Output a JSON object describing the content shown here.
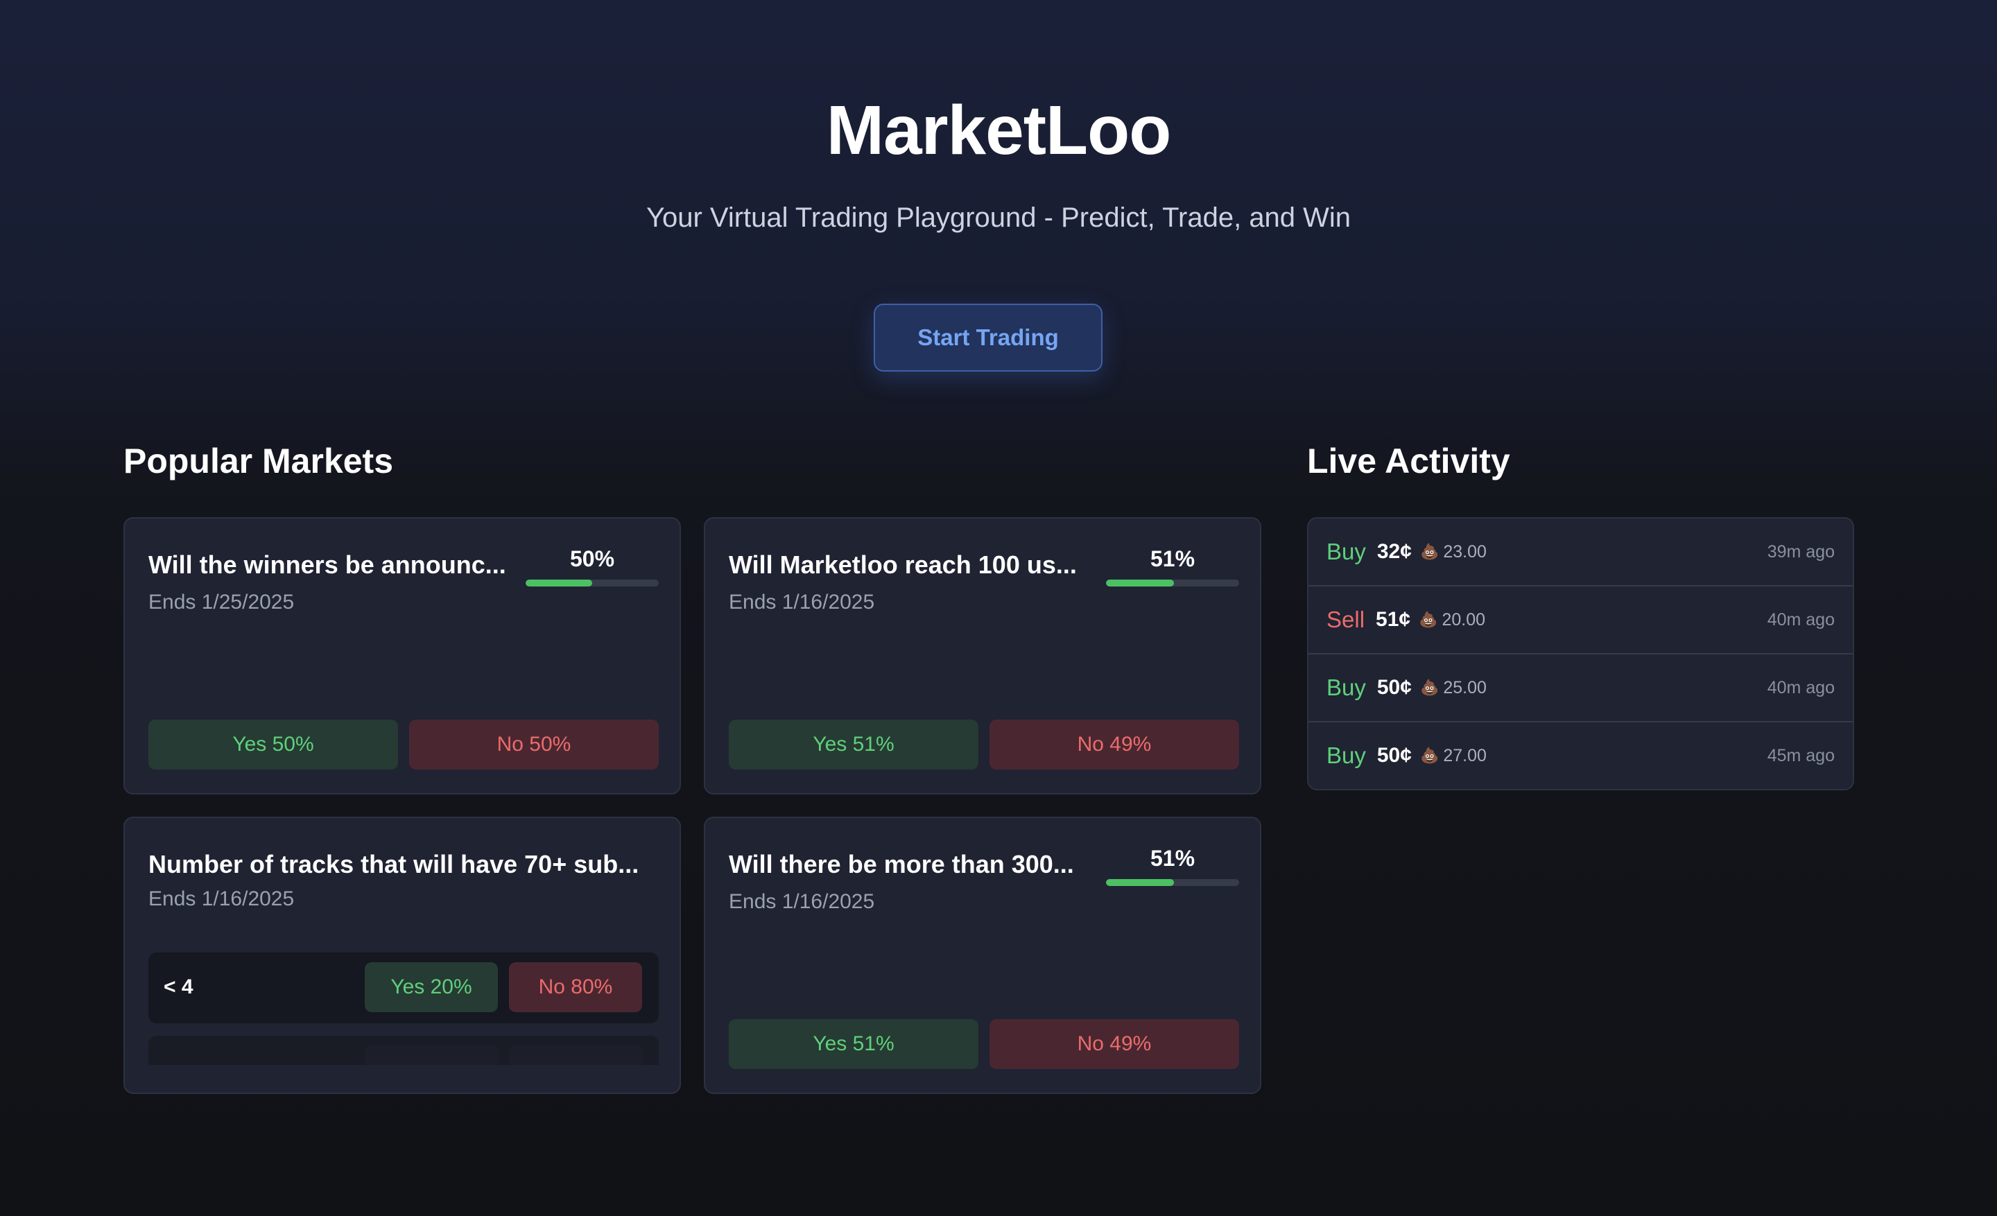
{
  "hero": {
    "title": "MarketLoo",
    "subtitle": "Your Virtual Trading Playground - Predict, Trade, and Win",
    "cta_label": "Start Trading"
  },
  "popular_markets": {
    "heading": "Popular Markets",
    "cards": [
      {
        "title": "Will the winners be announc...",
        "ends": "Ends 1/25/2025",
        "probability_label": "50%",
        "probability": 0.5,
        "yes_label": "Yes 50%",
        "no_label": "No 50%"
      },
      {
        "title": "Will Marketloo reach 100 us...",
        "ends": "Ends 1/16/2025",
        "probability_label": "51%",
        "probability": 0.51,
        "yes_label": "Yes 51%",
        "no_label": "No 49%"
      },
      {
        "title": "Number of tracks that will have 70+ sub...",
        "ends": "Ends 1/16/2025",
        "outcomes": [
          {
            "label": "< 4",
            "yes_label": "Yes 20%",
            "no_label": "No 80%"
          }
        ]
      },
      {
        "title": "Will there be more than 300...",
        "ends": "Ends 1/16/2025",
        "probability_label": "51%",
        "probability": 0.51,
        "yes_label": "Yes 51%",
        "no_label": "No 49%"
      }
    ]
  },
  "live_activity": {
    "heading": "Live Activity",
    "currency_icon": "poop-emoji-icon",
    "items": [
      {
        "side": "Buy",
        "price": "32¢",
        "amount": "23.00",
        "time": "39m ago"
      },
      {
        "side": "Sell",
        "price": "51¢",
        "amount": "20.00",
        "time": "40m ago"
      },
      {
        "side": "Buy",
        "price": "50¢",
        "amount": "25.00",
        "time": "40m ago"
      },
      {
        "side": "Buy",
        "price": "50¢",
        "amount": "27.00",
        "time": "45m ago"
      }
    ]
  },
  "colors": {
    "buy": "#5fd07b",
    "sell": "#ec6b6b",
    "accent": "#76a6f2",
    "progress": "#4cc163"
  }
}
